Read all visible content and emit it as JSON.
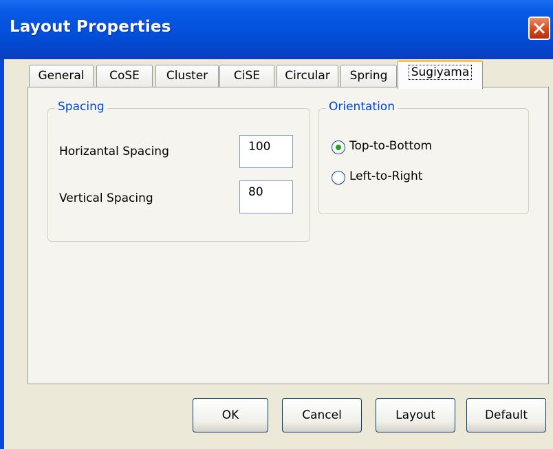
{
  "window": {
    "title": "Layout Properties"
  },
  "tabs": [
    {
      "label": "General",
      "active": false
    },
    {
      "label": "CoSE",
      "active": false
    },
    {
      "label": "Cluster",
      "active": false
    },
    {
      "label": "CiSE",
      "active": false
    },
    {
      "label": "Circular",
      "active": false
    },
    {
      "label": "Spring",
      "active": false
    },
    {
      "label": "Sugiyama",
      "active": true
    }
  ],
  "spacing": {
    "legend": "Spacing",
    "horizontal_label": "Horizantal Spacing",
    "horizontal_value": "100",
    "vertical_label": "Vertical Spacing",
    "vertical_value": "80"
  },
  "orientation": {
    "legend": "Orientation",
    "options": [
      {
        "label": "Top-to-Bottom",
        "checked": true
      },
      {
        "label": "Left-to-Right",
        "checked": false
      }
    ]
  },
  "buttons": {
    "ok": "OK",
    "cancel": "Cancel",
    "layout": "Layout",
    "default": "Default"
  },
  "colors": {
    "titlebar": "#0453df",
    "accent_label": "#0046d5",
    "active_tab_highlight": "#ffc83c",
    "radio_dot": "#21a121",
    "close_button": "#d2451c"
  }
}
